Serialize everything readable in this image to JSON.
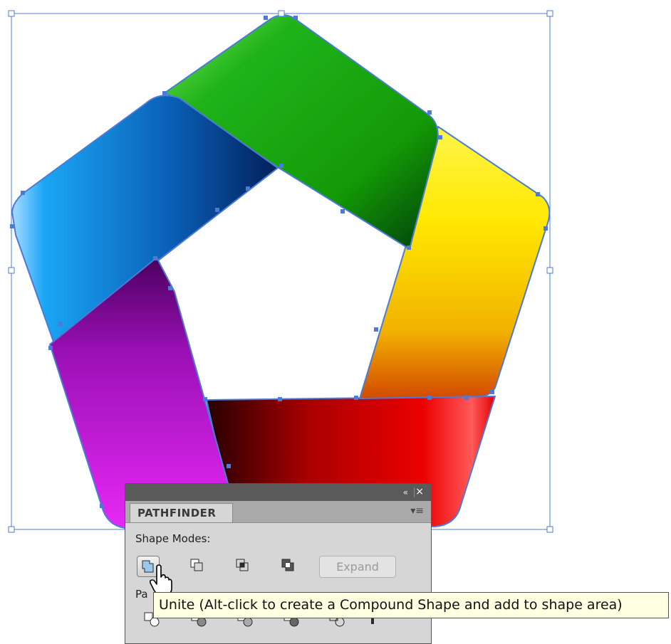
{
  "panel": {
    "tab_title": "PATHFINDER",
    "collapse_icon": "«",
    "close_icon": "×",
    "menu_icon": "▾≡",
    "shape_modes_label": "Shape Modes:",
    "pathfinders_label_partial": "Pa",
    "expand_label": "Expand",
    "shape_mode_buttons": [
      "unite-icon",
      "minus-front-icon",
      "intersect-icon",
      "exclude-icon"
    ],
    "pathfinder_buttons": [
      "divide-icon",
      "trim-icon",
      "merge-icon",
      "crop-icon",
      "outline-icon",
      "minus-back-icon"
    ]
  },
  "tooltip": {
    "text": "Unite (Alt-click to create a Compound Shape and add to shape area)"
  },
  "colors": {
    "selection": "#4a7bd6",
    "green": "#16a800",
    "yellow": "#fff200",
    "orange": "#f08a00",
    "red": "#e60000",
    "magenta": "#d81ee8",
    "purple": "#5c007a",
    "blue": "#1aa4f2",
    "navy": "#02205e",
    "tooltip_bg": "#ffffe1"
  }
}
